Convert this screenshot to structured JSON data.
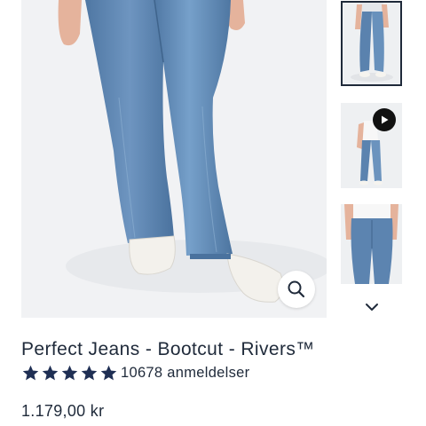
{
  "product": {
    "title": "Perfect Jeans - Bootcut - Rivers™",
    "rating_value": 5,
    "reviews_label": "10678 anmeldelser",
    "price": "1.179,00 kr"
  },
  "gallery": {
    "thumbnails": [
      {
        "name": "front-full-view",
        "selected": true,
        "has_video": false
      },
      {
        "name": "video-view",
        "selected": false,
        "has_video": true
      },
      {
        "name": "waist-detail-view",
        "selected": false,
        "has_video": false
      }
    ]
  },
  "icons": {
    "zoom": "magnifier-icon",
    "play": "play-icon",
    "next": "chevron-down-icon",
    "star": "star-icon"
  },
  "colors": {
    "text": "#1f2a3a",
    "star": "#1f2f54",
    "denim": "#5b82ad",
    "background": "#f1f2f4"
  }
}
